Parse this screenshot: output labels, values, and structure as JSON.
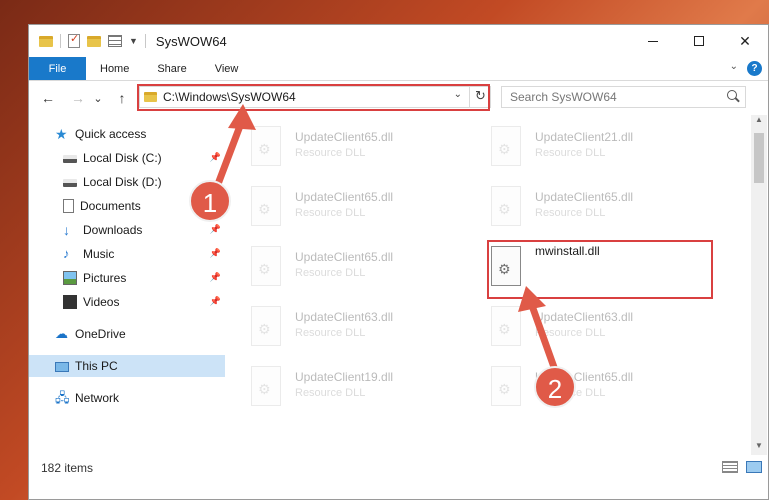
{
  "window": {
    "title": "SysWOW64",
    "controls": {
      "minimize": "",
      "maximize": "",
      "close": "✕"
    }
  },
  "ribbon": {
    "tabs": [
      "File",
      "Home",
      "Share",
      "View"
    ],
    "help": "?"
  },
  "nav": {
    "back": "←",
    "forward": "→",
    "recent": "⌄",
    "up": "↑",
    "address": "C:\\Windows\\SysWOW64",
    "search_placeholder": "Search SysWOW64"
  },
  "sidebar": {
    "items": [
      {
        "label": "Quick access",
        "icon": "star-icon"
      },
      {
        "label": "Local Disk (C:)",
        "icon": "disk-icon",
        "pinned": true
      },
      {
        "label": "Local Disk (D:)",
        "icon": "disk-icon"
      },
      {
        "label": "Documents",
        "icon": "documents-icon"
      },
      {
        "label": "Downloads",
        "icon": "downloads-icon",
        "pinned": true
      },
      {
        "label": "Music",
        "icon": "music-icon",
        "pinned": true
      },
      {
        "label": "Pictures",
        "icon": "pictures-icon",
        "pinned": true
      },
      {
        "label": "Videos",
        "icon": "videos-icon",
        "pinned": true
      },
      {
        "label": "OneDrive",
        "icon": "onedrive-icon"
      },
      {
        "label": "This PC",
        "icon": "this-pc-icon",
        "selected": true
      },
      {
        "label": "Network",
        "icon": "network-icon"
      }
    ]
  },
  "files": [
    {
      "name": "UpdateClient65.dll",
      "desc": "Resource DLL"
    },
    {
      "name": "UpdateClient21.dll",
      "desc": "Resource DLL"
    },
    {
      "name": "UpdateClient65.dll",
      "desc": "Resource DLL"
    },
    {
      "name": "UpdateClient65.dll",
      "desc": "Resource DLL"
    },
    {
      "name": "UpdateClient65.dll",
      "desc": "Resource DLL"
    },
    {
      "name": "mwinstall.dll",
      "desc": ""
    },
    {
      "name": "UpdateClient63.dll",
      "desc": "Resource DLL"
    },
    {
      "name": "UpdateClient63.dll",
      "desc": "Resource DLL"
    },
    {
      "name": "UpdateClient19.dll",
      "desc": "Resource DLL"
    },
    {
      "name": "UpdateClient65.dll",
      "desc": "Resource DLL"
    }
  ],
  "status": {
    "count": "182 items"
  },
  "annotations": {
    "badge1": "1",
    "badge2": "2",
    "accent": "#e05a48"
  }
}
